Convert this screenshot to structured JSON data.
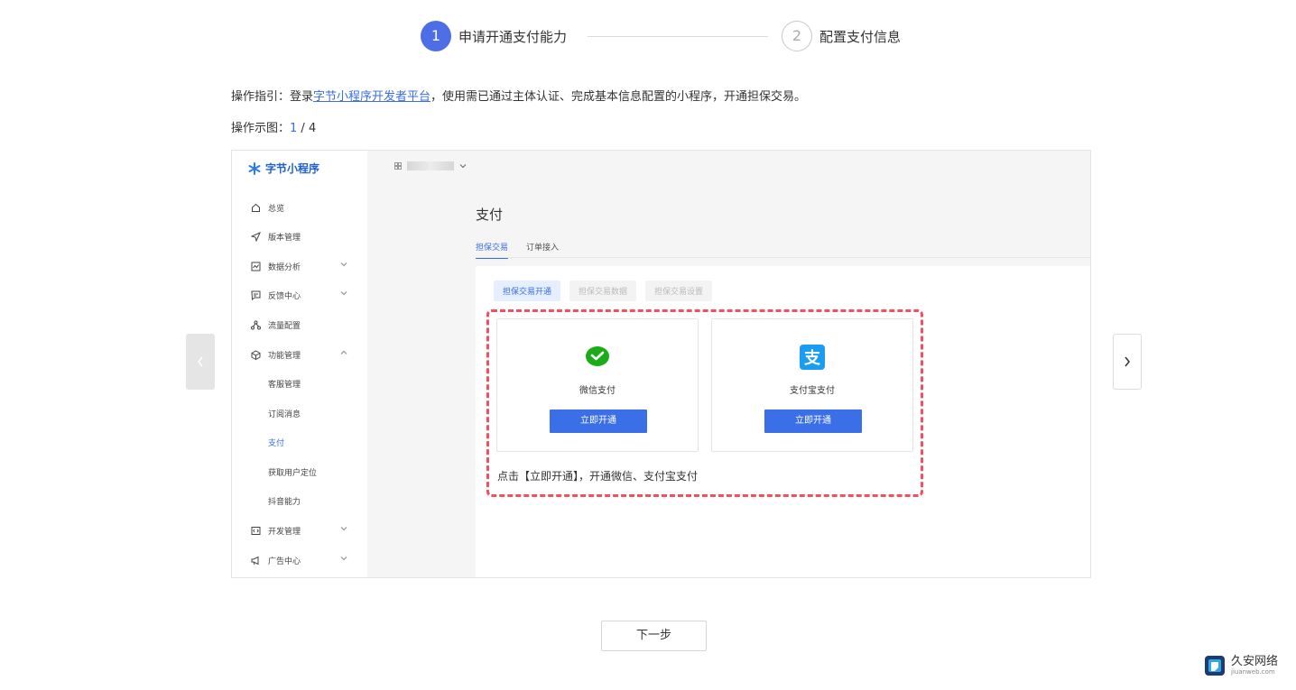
{
  "steps": [
    {
      "number": "1",
      "label": "申请开通支付能力"
    },
    {
      "number": "2",
      "label": "配置支付信息"
    }
  ],
  "guide": {
    "prefix": "操作指引：登录",
    "link": "字节小程序开发者平台",
    "suffix": "，使用需已通过主体认证、完成基本信息配置的小程序，开通担保交易。"
  },
  "example": {
    "label": "操作示图：",
    "current": "1",
    "separator": " / ",
    "total": "4"
  },
  "screenshot": {
    "logo": "字节小程序",
    "menu": [
      {
        "label": "总览",
        "icon": "home-icon"
      },
      {
        "label": "版本管理",
        "icon": "send-icon"
      },
      {
        "label": "数据分析",
        "icon": "chart-icon"
      },
      {
        "label": "反馈中心",
        "icon": "message-icon"
      },
      {
        "label": "流量配置",
        "icon": "network-icon"
      },
      {
        "label": "功能管理",
        "icon": "cube-icon"
      },
      {
        "label": "开发管理",
        "icon": "code-icon"
      },
      {
        "label": "广告中心",
        "icon": "megaphone-icon"
      }
    ],
    "submenu": [
      "客服管理",
      "订阅消息",
      "支付",
      "获取用户定位",
      "抖音能力"
    ],
    "page_title": "支付",
    "tabs": [
      "担保交易",
      "订单接入"
    ],
    "subtabs": [
      "担保交易开通",
      "担保交易数据",
      "担保交易设置"
    ],
    "cards": [
      {
        "name": "微信支付",
        "button": "立即开通",
        "icon": "wechat-pay-icon"
      },
      {
        "name": "支付宝支付",
        "button": "立即开通",
        "icon": "alipay-icon"
      }
    ],
    "hint": "点击【立即开通】，开通微信、支付宝支付"
  },
  "next_button": "下一步",
  "watermark": {
    "title": "久安网络",
    "subtitle": "jiuanweb.com"
  },
  "colors": {
    "accent": "#4e6ee6",
    "link": "#3a6fe0",
    "dashed": "#f05060"
  }
}
